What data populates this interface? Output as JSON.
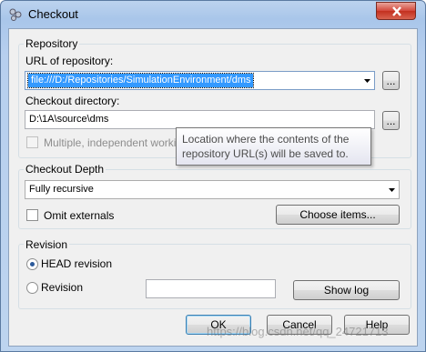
{
  "window": {
    "title": "Checkout"
  },
  "repository": {
    "group_label": "Repository",
    "url_label": "URL of repository:",
    "url_value": "file:///D:/Repositories/SimulationEnvironment/dms",
    "browse_label": "...",
    "dir_label": "Checkout directory:",
    "dir_value": "D:\\1A\\source\\dms",
    "dir_browse_label": "...",
    "multiple_label": "Multiple, independent working c"
  },
  "tooltip": {
    "line1": "Location where the contents of the",
    "line2": "repository URL(s) will be saved to."
  },
  "depth": {
    "group_label": "Checkout Depth",
    "selected": "Fully recursive",
    "omit_label": "Omit externals",
    "choose_label": "Choose items..."
  },
  "revision": {
    "group_label": "Revision",
    "head_label": "HEAD revision",
    "rev_label": "Revision",
    "rev_value": "",
    "show_log_label": "Show log"
  },
  "buttons": {
    "ok": "OK",
    "cancel": "Cancel",
    "help": "Help"
  },
  "watermark": "https://blog.csdn.net/qq_24721713",
  "icons": [
    "app-icon",
    "close-icon",
    "dropdown-arrow-icon"
  ]
}
